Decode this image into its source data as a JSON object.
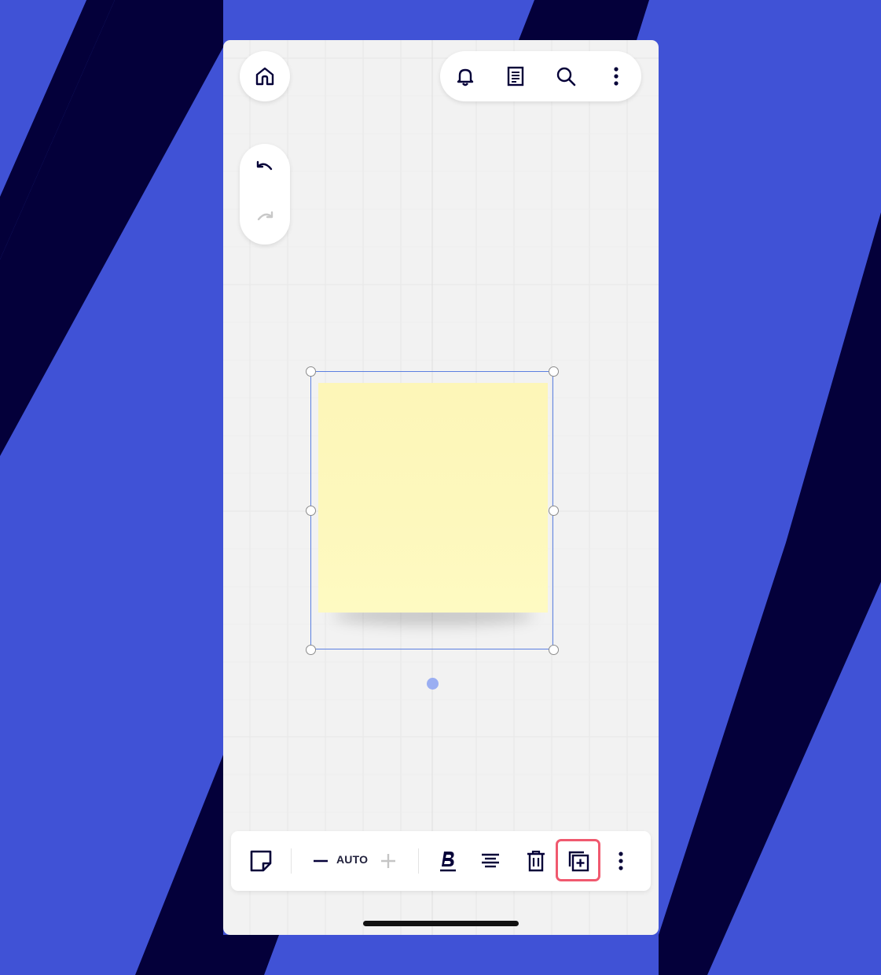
{
  "colors": {
    "background_blue": "#4052d6",
    "background_stripe": "#04003a",
    "canvas": "#f2f2f2",
    "sticky_note": "#fdf7ba",
    "selection": "#5b7fe0",
    "highlight": "#f0596f",
    "icon": "#050038"
  },
  "top_left": {
    "home_icon": "home-icon"
  },
  "top_right": {
    "icons": [
      "bell-icon",
      "document-icon",
      "search-icon",
      "more-vertical-icon"
    ]
  },
  "history": {
    "undo_icon": "undo-icon",
    "redo_icon": "redo-icon",
    "redo_enabled": false
  },
  "canvas": {
    "sticky_note": {
      "color": "light-yellow",
      "text": ""
    }
  },
  "toolbar": {
    "items": [
      "sticky-note-shape-icon",
      "decrease-font-icon",
      "increase-font-icon",
      "bold-icon",
      "align-center-icon",
      "trash-icon",
      "duplicate-icon",
      "more-vertical-icon"
    ],
    "font_size_label": "AUTO",
    "highlighted_item": "duplicate-icon"
  }
}
